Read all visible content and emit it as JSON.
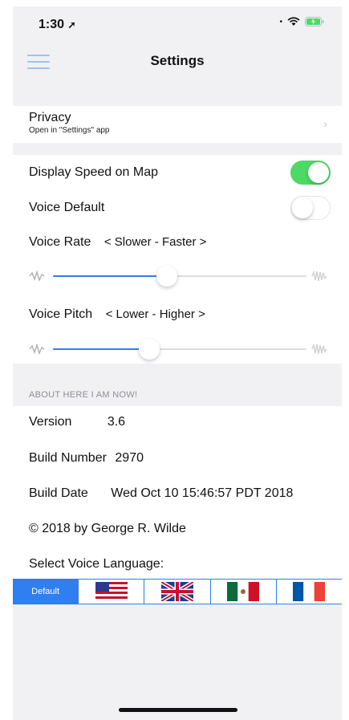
{
  "status": {
    "time": "1:30"
  },
  "nav": {
    "title": "Settings"
  },
  "privacy": {
    "label": "Privacy",
    "subtitle": "Open in \"Settings\" app"
  },
  "options": {
    "display_speed_label": "Display Speed on Map",
    "display_speed_on": true,
    "voice_default_label": "Voice Default",
    "voice_default_on": false,
    "voice_rate_label": "Voice Rate",
    "voice_rate_hint": "< Slower - Faster >",
    "voice_rate_value": 0.45,
    "voice_pitch_label": "Voice Pitch",
    "voice_pitch_hint": "< Lower - Higher >",
    "voice_pitch_value": 0.38
  },
  "about": {
    "header": "ABOUT HERE I AM NOW!",
    "version_label": "Version",
    "version_value": "3.6",
    "build_number_label": "Build Number",
    "build_number_value": "2970",
    "build_date_label": "Build Date",
    "build_date_value": "Wed Oct 10 15:46:57 PDT 2018",
    "copyright": "© 2018 by George R. Wilde",
    "select_language_label": "Select Voice Language:"
  },
  "languages": {
    "selected": "Default",
    "flags": [
      "us-flag-icon",
      "uk-flag-icon",
      "mexico-flag-icon",
      "france-flag-icon"
    ]
  },
  "colors": {
    "accent": "#2f7ff0",
    "toggle_on": "#4cd964",
    "background": "#f1f1f4"
  }
}
